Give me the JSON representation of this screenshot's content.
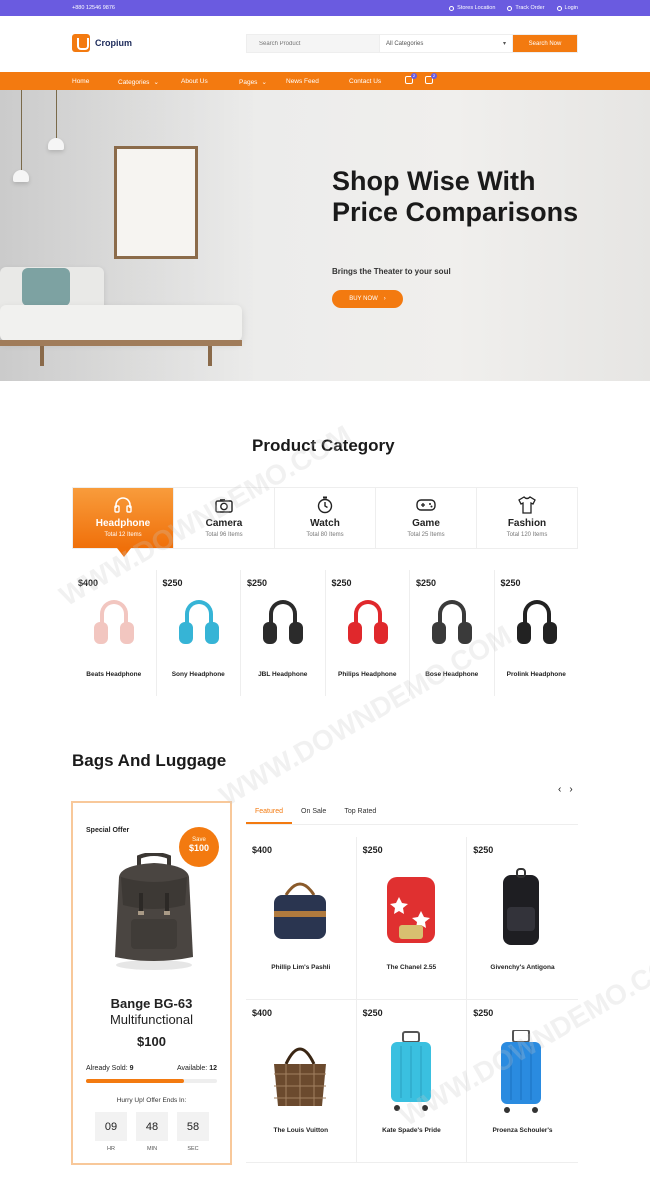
{
  "topbar": {
    "phone": "+880 12546 9876",
    "links": [
      "Stores Location",
      "Track Order",
      "Login"
    ]
  },
  "header": {
    "logo": "Cropium",
    "search_placeholder": "Search Product",
    "category": "All Categories",
    "search_button": "Search Now"
  },
  "nav": {
    "items": [
      "Home",
      "Categories",
      "About Us",
      "Pages",
      "News Feed",
      "Contact Us"
    ],
    "wishlist_count": "2",
    "cart_count": "2"
  },
  "hero": {
    "title": "Shop Wise With Price Comparisons",
    "subtitle": "Brings the Theater to your soul",
    "button": "BUY NOW"
  },
  "product_category": {
    "title": "Product Category",
    "categories": [
      {
        "name": "Headphone",
        "total": "Total 12 Items",
        "icon": "headphone-icon"
      },
      {
        "name": "Camera",
        "total": "Total 96 Items",
        "icon": "camera-icon"
      },
      {
        "name": "Watch",
        "total": "Total 80 Items",
        "icon": "watch-icon"
      },
      {
        "name": "Game",
        "total": "Total 25 Items",
        "icon": "gamepad-icon"
      },
      {
        "name": "Fashion",
        "total": "Total 120 Items",
        "icon": "shirt-icon"
      }
    ],
    "products": [
      {
        "price": "$400",
        "name": "Beats Headphone",
        "color": "#f2c6c0"
      },
      {
        "price": "$250",
        "name": "Sony Headphone",
        "color": "#36b4d6"
      },
      {
        "price": "$250",
        "name": "JBL Headphone",
        "color": "#2b2b2b"
      },
      {
        "price": "$250",
        "name": "Philips Headphone",
        "color": "#e0282c"
      },
      {
        "price": "$250",
        "name": "Bose Headphone",
        "color": "#3a3a3a"
      },
      {
        "price": "$250",
        "name": "Prolink Headphone",
        "color": "#222222"
      }
    ]
  },
  "bags": {
    "title": "Bags And Luggage",
    "tabs": [
      "Featured",
      "On Sale",
      "Top Rated"
    ],
    "offer": {
      "label": "Special Offer",
      "save_label": "Save",
      "save_amount": "$100",
      "title": "Bange BG-63",
      "subtitle": "Multifunctional",
      "price": "$100",
      "sold_label": "Already Sold:",
      "sold": "9",
      "available_label": "Available:",
      "available": "12",
      "progress": 0.75,
      "hurry": "Hurry Up! Offer Ends In:",
      "timer": [
        {
          "value": "09",
          "label": "HR"
        },
        {
          "value": "48",
          "label": "MIN"
        },
        {
          "value": "58",
          "label": "SEC"
        }
      ]
    },
    "items": [
      {
        "price": "$400",
        "name": "Phillip Lim's Pashli",
        "color": "#2a3550"
      },
      {
        "price": "$250",
        "name": "The Chanel 2.55",
        "color": "#e03030"
      },
      {
        "price": "$250",
        "name": "Givenchy's Antigona",
        "color": "#1e1e22"
      },
      {
        "price": "$400",
        "name": "The Louis Vuitton",
        "color": "#6b4a2e"
      },
      {
        "price": "$250",
        "name": "Kate Spade's Pride",
        "color": "#3ac0e0"
      },
      {
        "price": "$250",
        "name": "Proenza Schouler's",
        "color": "#2a8be0"
      }
    ]
  }
}
